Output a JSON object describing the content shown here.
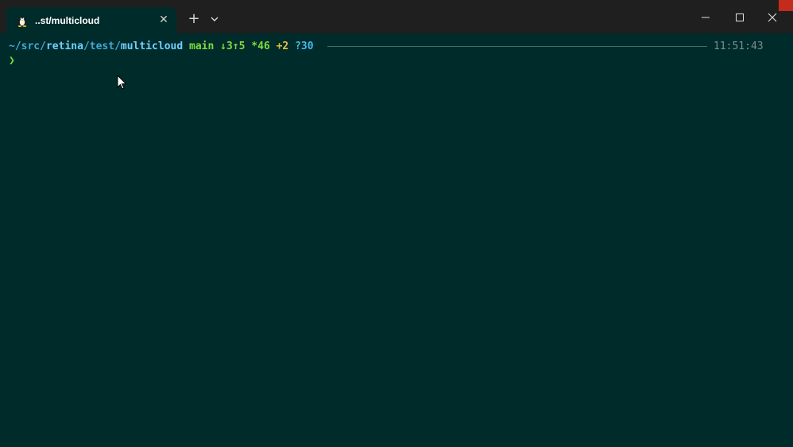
{
  "tab": {
    "title": "..st/multicloud",
    "icon": "linux-tux-icon",
    "close_label": "✕"
  },
  "toolbar": {
    "new_tab_label": "+",
    "dropdown_icon": "chevron-down-icon"
  },
  "window_controls": {
    "minimize_icon": "minimize-icon",
    "maximize_icon": "maximize-icon",
    "close_icon": "close-icon"
  },
  "prompt": {
    "path_prefix": "~/src/",
    "path_seg1": "retina",
    "path_sep1": "/",
    "path_seg2": "test",
    "path_sep2": "/",
    "path_seg3": "multicloud",
    "branch": "main",
    "ahead_behind": "↓3↑5",
    "staged": "*46",
    "modified": "+2",
    "untracked": "?30",
    "time": "11:51:43",
    "symbol": "❯"
  },
  "colors": {
    "terminal_bg": "#002b2b",
    "titlebar_bg": "#1f1f1f",
    "path": "#3fa9d6",
    "branch": "#7bdc3f",
    "modified": "#e0c040",
    "untracked": "#3fb9e6"
  }
}
